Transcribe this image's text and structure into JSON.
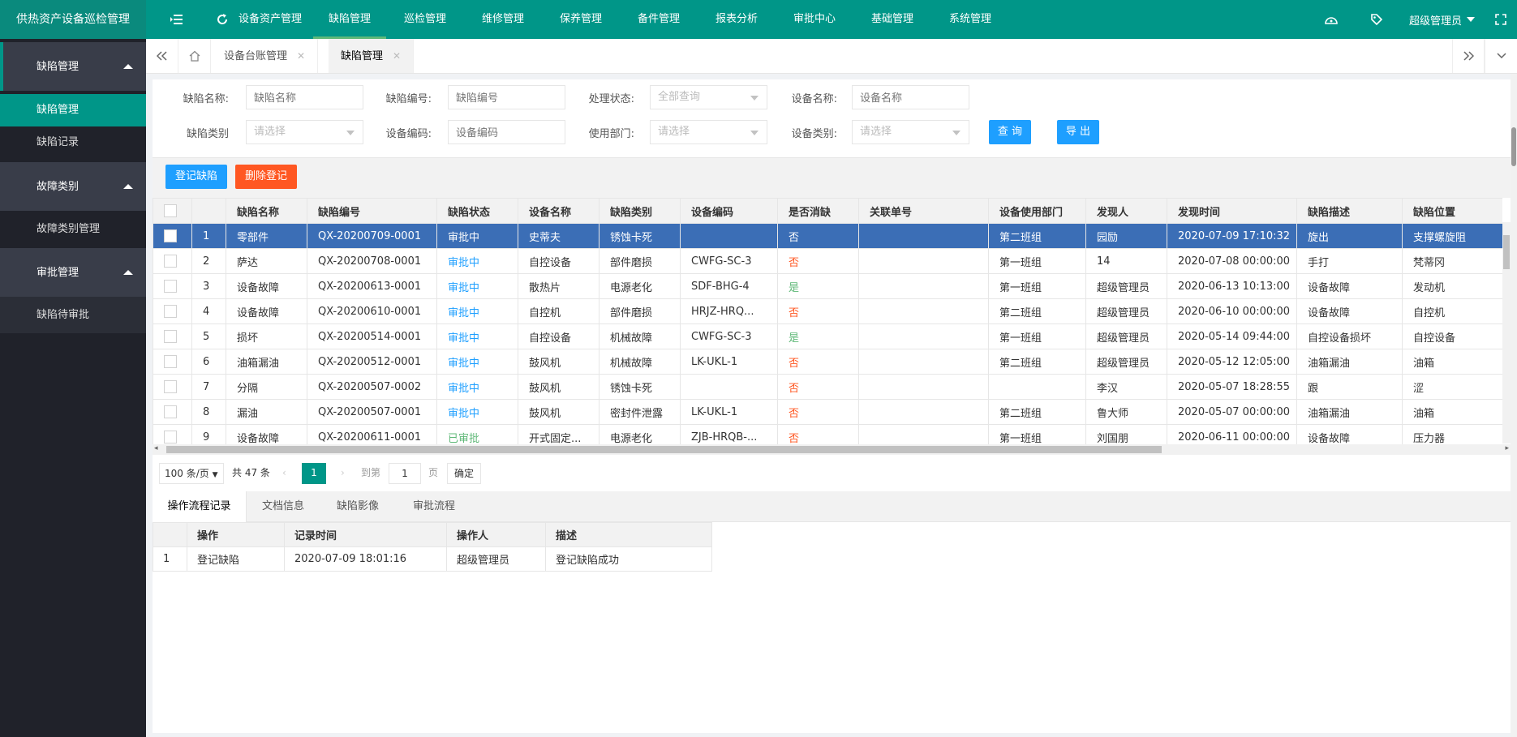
{
  "app": {
    "title": "供热资产设备巡检管理"
  },
  "topnav": {
    "items": [
      "设备资产管理",
      "缺陷管理",
      "巡检管理",
      "维修管理",
      "保养管理",
      "备件管理",
      "报表分析",
      "审批中心",
      "基础管理",
      "系统管理"
    ],
    "active_index": 1,
    "user": "超级管理员"
  },
  "sidebar": {
    "groups": [
      {
        "label": "缺陷管理",
        "items": [
          "缺陷管理",
          "缺陷记录"
        ]
      },
      {
        "label": "故障类别",
        "items": [
          "故障类别管理"
        ]
      },
      {
        "label": "审批管理",
        "items": [
          "缺陷待审批"
        ]
      }
    ]
  },
  "tabs": [
    {
      "label": "设备台账管理"
    },
    {
      "label": "缺陷管理"
    }
  ],
  "filters": {
    "defect_name": {
      "label": "缺陷名称:",
      "placeholder": "缺陷名称"
    },
    "defect_no": {
      "label": "缺陷编号:",
      "placeholder": "缺陷编号"
    },
    "status": {
      "label": "处理状态:",
      "value": "全部查询"
    },
    "device_name": {
      "label": "设备名称:",
      "placeholder": "设备名称"
    },
    "defect_type": {
      "label": "缺陷类别",
      "value": "请选择"
    },
    "device_code": {
      "label": "设备编码:",
      "placeholder": "设备编码"
    },
    "dept": {
      "label": "使用部门:",
      "value": "请选择"
    },
    "device_type": {
      "label": "设备类别:",
      "value": "请选择"
    },
    "query_btn": "查 询",
    "export_btn": "导 出"
  },
  "toolbar": {
    "register_btn": "登记缺陷",
    "delete_btn": "删除登记"
  },
  "grid": {
    "headers": [
      "",
      "",
      "缺陷名称",
      "缺陷编号",
      "缺陷状态",
      "设备名称",
      "缺陷类别",
      "设备编码",
      "是否消缺",
      "关联单号",
      "设备使用部门",
      "发现人",
      "发现时间",
      "缺陷描述",
      "缺陷位置"
    ],
    "rows": [
      [
        "1",
        "零部件",
        "QX-20200709-0001",
        "审批中",
        "史蒂夫",
        "锈蚀卡死",
        "",
        "否",
        "",
        "第二班组",
        "园励",
        "2020-07-09 17:10:32",
        "旋出",
        "支撑螺旋阻"
      ],
      [
        "2",
        "萨达",
        "QX-20200708-0001",
        "审批中",
        "自控设备",
        "部件磨损",
        "CWFG-SC-3",
        "否",
        "",
        "第一班组",
        "14",
        "2020-07-08 00:00:00",
        "手打",
        "梵蒂冈"
      ],
      [
        "3",
        "设备故障",
        "QX-20200613-0001",
        "审批中",
        "散热片",
        "电源老化",
        "SDF-BHG-4",
        "是",
        "",
        "第一班组",
        "超级管理员",
        "2020-06-13 10:13:00",
        "设备故障",
        "发动机"
      ],
      [
        "4",
        "设备故障",
        "QX-20200610-0001",
        "审批中",
        "自控机",
        "部件磨损",
        "HRJZ-HRQ...",
        "否",
        "",
        "第二班组",
        "超级管理员",
        "2020-06-10 00:00:00",
        "设备故障",
        "自控机"
      ],
      [
        "5",
        "损坏",
        "QX-20200514-0001",
        "审批中",
        "自控设备",
        "机械故障",
        "CWFG-SC-3",
        "是",
        "",
        "第一班组",
        "超级管理员",
        "2020-05-14 09:44:00",
        "自控设备损坏",
        "自控设备"
      ],
      [
        "6",
        "油箱漏油",
        "QX-20200512-0001",
        "审批中",
        "鼓风机",
        "机械故障",
        "LK-UKL-1",
        "否",
        "",
        "第二班组",
        "超级管理员",
        "2020-05-12 12:05:00",
        "油箱漏油",
        "油箱"
      ],
      [
        "7",
        "分隔",
        "QX-20200507-0002",
        "审批中",
        "鼓风机",
        "锈蚀卡死",
        "",
        "否",
        "",
        "",
        "李汉",
        "2020-05-07 18:28:55",
        "跟",
        "涩"
      ],
      [
        "8",
        "漏油",
        "QX-20200507-0001",
        "审批中",
        "鼓风机",
        "密封件泄露",
        "LK-UKL-1",
        "否",
        "",
        "第二班组",
        "鲁大师",
        "2020-05-07 00:00:00",
        "油箱漏油",
        "油箱"
      ],
      [
        "9",
        "设备故障",
        "QX-20200611-0001",
        "已审批",
        "开式固定...",
        "电源老化",
        "ZJB-HRQB-...",
        "否",
        "",
        "第一班组",
        "刘国朋",
        "2020-06-11 00:00:00",
        "设备故障",
        "压力器"
      ]
    ],
    "selected_row": 0
  },
  "pager": {
    "page_size": "100 条/页",
    "total": "共 47 条",
    "current": "1",
    "goto_label": "到第",
    "goto_value": "1",
    "page_unit": "页",
    "confirm": "确定"
  },
  "bottom_tabs": [
    "操作流程记录",
    "文档信息",
    "缺陷影像",
    "审批流程"
  ],
  "flow_table": {
    "headers": [
      "",
      "操作",
      "记录时间",
      "操作人",
      "描述"
    ],
    "rows": [
      [
        "1",
        "登记缺陷",
        "2020-07-09 18:01:16",
        "超级管理员",
        "登记缺陷成功"
      ]
    ]
  },
  "colors": {
    "primary": "#009688",
    "selected_row": "#3b6eb6",
    "blue": "#1e9fff",
    "orange": "#ff5722",
    "sidebar": "#20222a"
  }
}
